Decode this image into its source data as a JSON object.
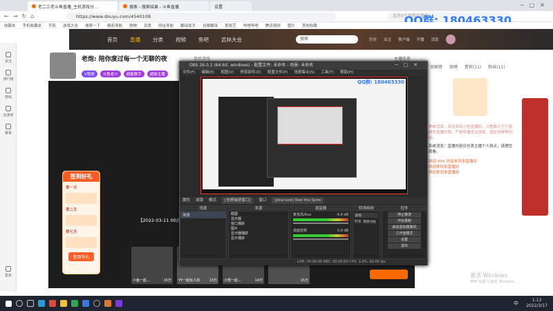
{
  "watermark": "QQ群: 180463330",
  "browser": {
    "tabs": [
      "老二三老斗鱼直播_主机游戏分...",
      "搜索 - 搜索结果 - 斗鱼直播",
      "设置"
    ],
    "url": "https://www.douyu.com/4540108",
    "search_placeholder": "点开3个风险应用中",
    "bookmarks": [
      "收藏夹",
      "手机收藏夹",
      "手机",
      "游戏大全",
      "搜索一下",
      "精彩导航",
      "购物",
      "百度",
      "网址导航",
      "翻译助手",
      "谷歌翻译",
      "爱奇艺",
      "哔哩哔哩",
      "腾讯视频",
      "图片",
      "其他收藏"
    ]
  },
  "site": {
    "nav": [
      "首页",
      "直播",
      "分类",
      "视频",
      "鱼吧",
      "武林大会"
    ],
    "search_value": "搜索",
    "header_icons": [
      "历史",
      "关注",
      "客户端",
      "开播",
      "消息"
    ]
  },
  "rail": [
    "关注",
    "排行榜",
    "游戏",
    "云游戏",
    "赛事",
    "更多"
  ],
  "streamer": {
    "title": "老炮: 陪你度过每一个无聊的夜",
    "category": "单机游戏",
    "tag": "V我爸",
    "badges": [
      "斗鱼老人",
      "超能歌手",
      "超级主播"
    ],
    "right_link": "主播任务"
  },
  "video": {
    "overlay_title": "签到好礼",
    "rewards": [
      "第一天",
      "第二天",
      "第七天"
    ],
    "checkin_button": "签到有礼",
    "date_text": "【2022-03-11 00点",
    "cards": [
      {
        "label": "小鱼一起...",
        "count": "15万"
      },
      {
        "label": "YY一起玩人的",
        "count": "13万"
      },
      {
        "label": "小怪一起...",
        "count": "14万"
      },
      {
        "label": "",
        "count": "15万"
      }
    ]
  },
  "right_panel": {
    "ranks": [
      "贡献榜",
      "周榜",
      "贵宾(11)",
      "粉丝(11)"
    ],
    "chat": [
      "系统消息：欢迎来到斗鱼直播间，斗鱼致力于打造绿色直播环境，严禁传播违法违规、低俗色情等内容。",
      "系统消息：直播内容仅代表主播个人观点，请理性观看。",
      "欢迎 XXX 欢迎来到本直播间",
      "欢迎来到本直播间",
      "欢迎来到本直播间"
    ],
    "windows_activate": "激活 Windows",
    "windows_activate_sub": "转到\"设置\"以激活 Windows。"
  },
  "obs": {
    "title": "OBS 26.0.2 (64-bit, windows) - 配置文件: 未命名 - 场景: 未命名",
    "menu": [
      "文件(F)",
      "编辑(E)",
      "视图(V)",
      "停靠部件(D)",
      "配置文件(P)",
      "场景集合(S)",
      "工具(T)",
      "帮助(H)"
    ],
    "preview_watermark": "QQ群: 180463330",
    "toolbar": [
      "属性",
      "滤镜",
      "模式",
      "[全屏捕获窗口]",
      "窗口",
      "[jstar.exe] Star the Spire"
    ],
    "docks": {
      "scenes": {
        "header": "场景",
        "items": [
          "场景"
        ]
      },
      "sources": {
        "header": "来源",
        "items": [
          "截图",
          "显示器",
          "窗口捕获",
          "图片",
          "显示器捕获",
          "显示捕获"
        ]
      },
      "mixer": {
        "header": "混音器",
        "items": [
          "麦克风/Aux",
          "桌面音频"
        ],
        "db": [
          "-9.9 dB",
          "0.0 dB"
        ]
      },
      "transitions": {
        "header": "转场特效",
        "type": "淡出",
        "duration_label": "时长",
        "duration": "300 ms"
      },
      "controls": {
        "header": "控件",
        "buttons": [
          "停止推流",
          "开始录制",
          "启动虚拟摄像机",
          "工作室模式",
          "设置",
          "退出"
        ]
      }
    },
    "status": "LIVE: 00:00:00  REC: 00:00:00  CPU: 3.9%, 60.00 fps"
  },
  "taskbar": {
    "time": "1:13",
    "date": "2022/3/17",
    "ime": "中"
  },
  "colors": {
    "accent": "#ff6a00",
    "douyu_orange": "#ff5d23",
    "obs_bg": "#2b2b2b",
    "record_red": "#e33333"
  }
}
